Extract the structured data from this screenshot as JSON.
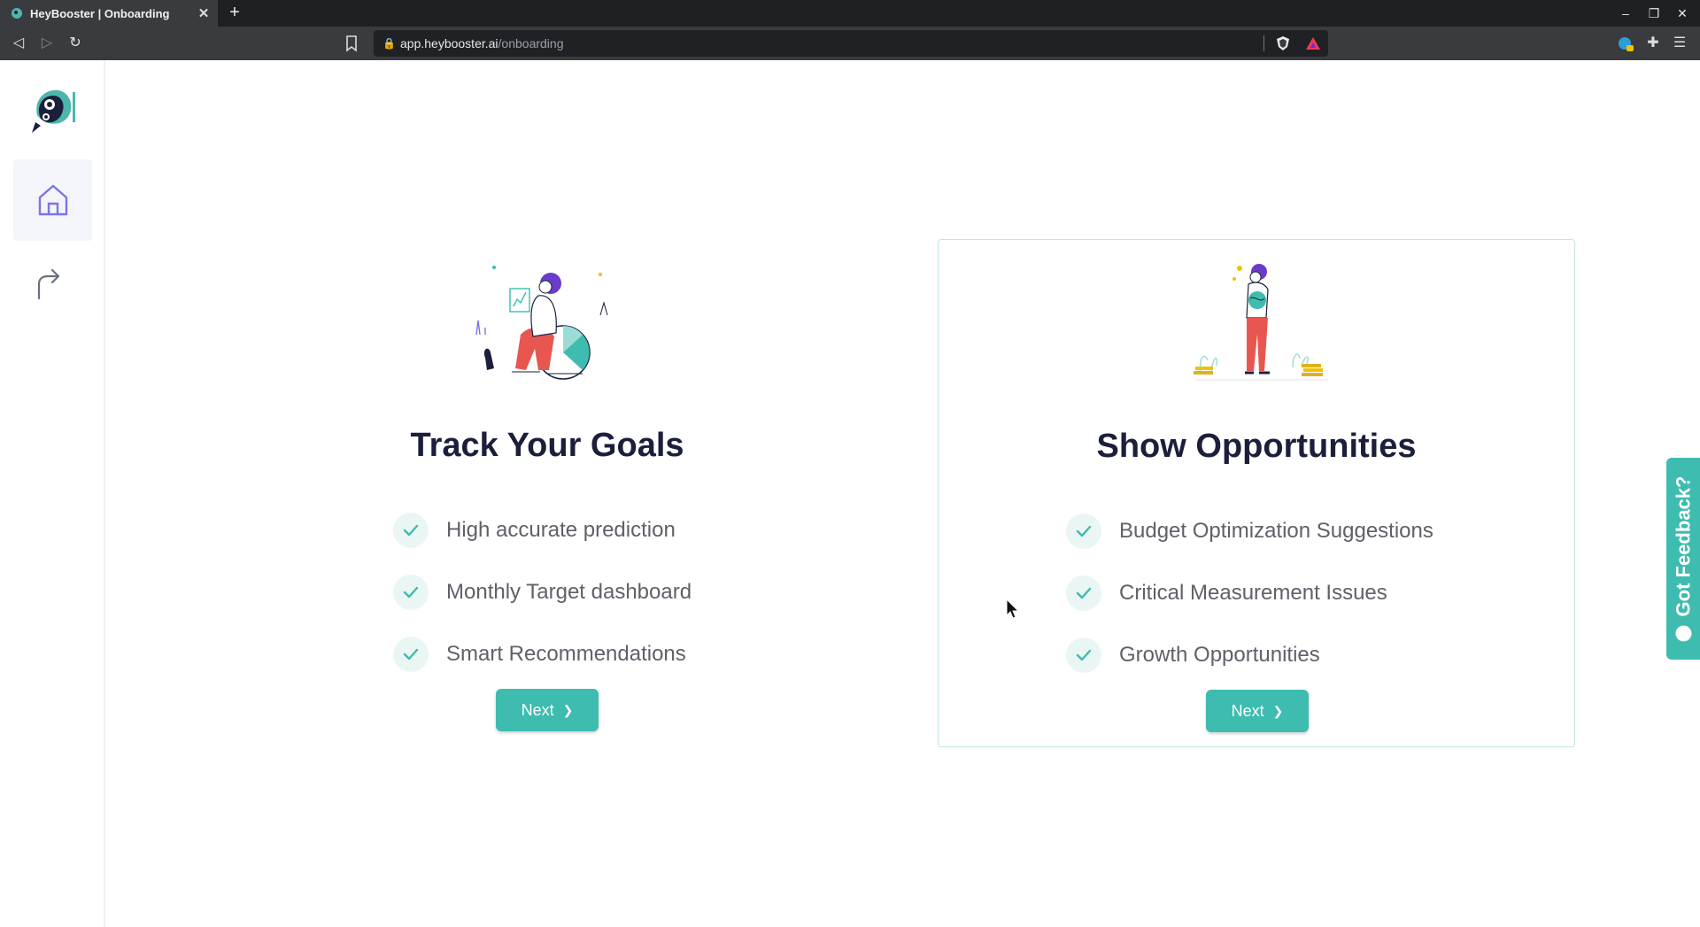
{
  "browser": {
    "tab_title": "HeyBooster | Onboarding",
    "url_host": "app.heybooster.ai",
    "url_path": "/onboarding"
  },
  "sidebar": {
    "items": [
      {
        "icon": "home-icon",
        "active": true
      },
      {
        "icon": "share-icon",
        "active": false
      }
    ]
  },
  "cards": [
    {
      "title": "Track Your Goals",
      "features": [
        "High accurate prediction",
        "Monthly Target dashboard",
        "Smart Recommendations"
      ],
      "button_label": "Next",
      "selected": false
    },
    {
      "title": "Show Opportunities",
      "features": [
        "Budget Optimization Suggestions",
        "Critical Measurement Issues",
        "Growth Opportunities"
      ],
      "button_label": "Next",
      "selected": true
    }
  ],
  "feedback": {
    "label": "Got Feedback?"
  },
  "colors": {
    "accent": "#3dbcaf",
    "title": "#1b1f3b",
    "text": "#5f6169",
    "check_bg": "#eaf6f4"
  }
}
